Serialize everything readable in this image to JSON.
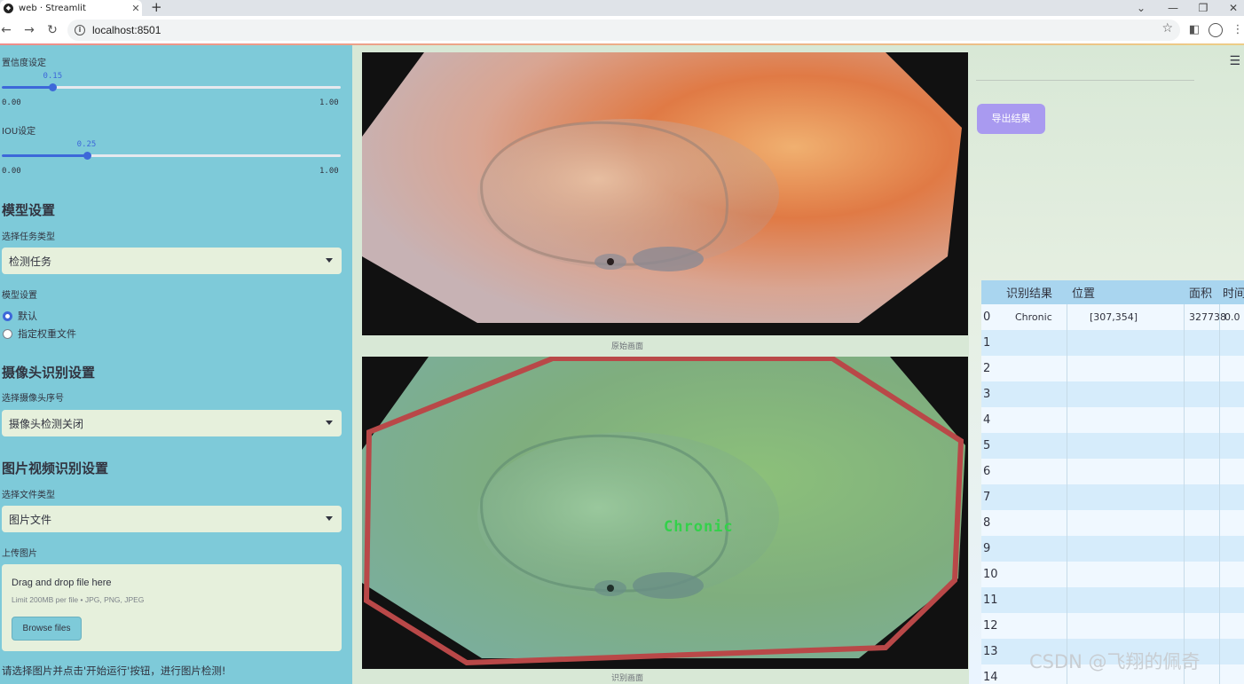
{
  "browser": {
    "tab_title": "web · Streamlit",
    "url": "localhost:8501"
  },
  "sidebar": {
    "conf_label": "置信度设定",
    "conf_value": "0.15",
    "conf_level": 0.15,
    "conf_min": "0.00",
    "conf_max": "1.00",
    "iou_label": "IOU设定",
    "iou_value": "0.25",
    "iou_level": 0.25,
    "iou_min": "0.00",
    "iou_max": "1.00",
    "model_heading": "模型设置",
    "task_label": "选择任务类型",
    "task_value": "检测任务",
    "model_label": "模型设置",
    "model_options": [
      "默认",
      "指定权重文件"
    ],
    "model_selected": "默认",
    "camera_heading": "摄像头识别设置",
    "camera_label": "选择摄像头序号",
    "camera_value": "摄像头检测关闭",
    "file_heading": "图片视频识别设置",
    "filetype_label": "选择文件类型",
    "filetype_value": "图片文件",
    "upload_label": "上传图片",
    "upload_title": "Drag and drop file here",
    "upload_limit": "Limit 200MB per file • JPG, PNG, JPEG",
    "browse_button": "Browse files",
    "hint": "请选择图片并点击'开始运行'按钮，进行图片检测!"
  },
  "main": {
    "original_caption": "原始画面",
    "result_caption": "识别画面",
    "detection_label": "Chronic"
  },
  "results": {
    "export_button": "导出结果",
    "columns": [
      "识别结果",
      "位置",
      "面积",
      "时间"
    ],
    "rows": [
      {
        "index": "0",
        "result": "Chronic",
        "position": "[307,354]",
        "area": "327738",
        "time": "0.0"
      },
      {
        "index": "1"
      },
      {
        "index": "2"
      },
      {
        "index": "3"
      },
      {
        "index": "4"
      },
      {
        "index": "5"
      },
      {
        "index": "6"
      },
      {
        "index": "7"
      },
      {
        "index": "8"
      },
      {
        "index": "9"
      },
      {
        "index": "10"
      },
      {
        "index": "11"
      },
      {
        "index": "12"
      },
      {
        "index": "13"
      },
      {
        "index": "14"
      }
    ]
  },
  "watermark": "CSDN @飞翔的佩奇",
  "colors": {
    "sidebar_bg": "#7ecad9",
    "accent": "#3d68d9",
    "export_button": "#a99af0",
    "detection_box": "#b94848",
    "detection_text": "#33d14a"
  }
}
